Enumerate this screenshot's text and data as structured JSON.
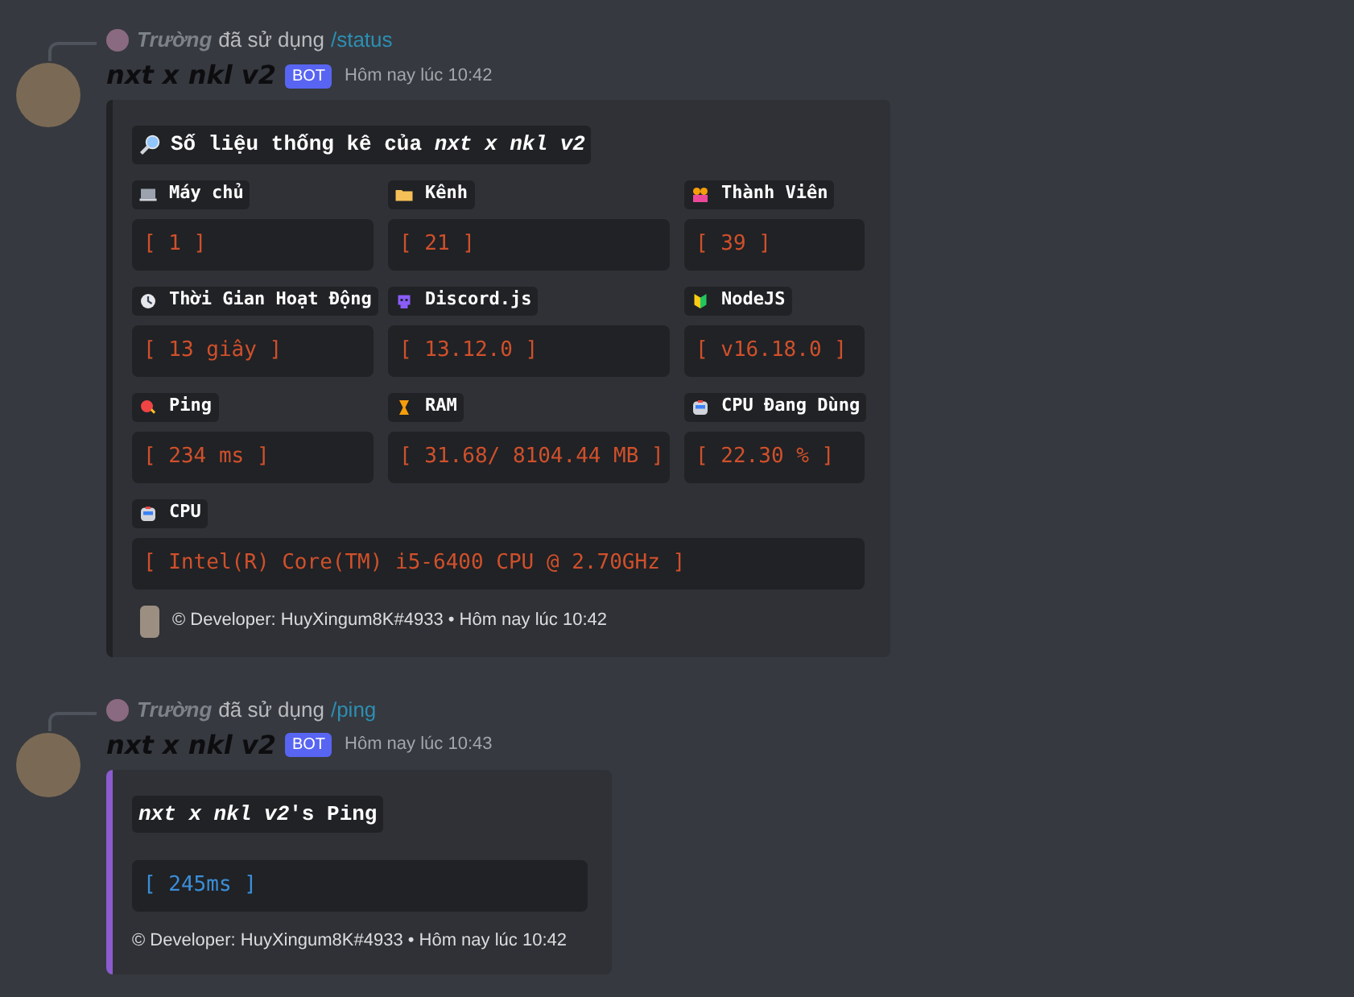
{
  "messages": [
    {
      "reply": {
        "user": "Trường",
        "action": "đã sử dụng",
        "command": "/status"
      },
      "author": "nxt x nkl v2",
      "badge": "BOT",
      "time": "Hôm nay lúc 10:42",
      "embed": {
        "kind": "stats",
        "title": "Số liệu thống kê của **nxt x nkl v2**",
        "fields": [
          {
            "label": "Máy chủ",
            "value": "[ 1 ]",
            "inline": true
          },
          {
            "label": "Kênh",
            "value": "[ 21 ]",
            "inline": true
          },
          {
            "label": "Thành Viên",
            "value": "[ 39 ]",
            "inline": true
          },
          {
            "label": "Thời Gian Hoạt Động",
            "value": "[ 13 giây ]",
            "inline": true
          },
          {
            "label": "Discord.js",
            "value": "[ 13.12.0 ]",
            "inline": true
          },
          {
            "label": "NodeJS",
            "value": "[ v16.18.0 ]",
            "inline": true
          },
          {
            "label": "Ping",
            "value": "[ 234 ms ]",
            "inline": true
          },
          {
            "label": "RAM",
            "value": "[ 31.68/ 8104.44 MB ]",
            "inline": true
          },
          {
            "label": "CPU Đang Dùng",
            "value": "[ 22.30 % ]",
            "inline": true
          },
          {
            "label": "CPU",
            "value": "[ Intel(R) Core(TM) i5-6400 CPU @ 2.70GHz ]",
            "inline": false
          }
        ],
        "footer": "© Developer: HuyXingum8K#4933 • Hôm nay lúc 10:42",
        "color": "#202225"
      }
    },
    {
      "reply": {
        "user": "Trường",
        "action": "đã sử dụng",
        "command": "/ping"
      },
      "author": "nxt x nkl v2",
      "badge": "BOT",
      "time": "Hôm nay lúc 10:43",
      "embed": {
        "kind": "ping",
        "title": "**nxt x nkl v2**'s Ping",
        "fields": [
          {
            "value": "[ 245ms ]"
          }
        ],
        "footer": "© Developer: HuyXingum8K#4933 • Hôm nay lúc 10:42",
        "color": "#8b5cd0"
      }
    }
  ]
}
